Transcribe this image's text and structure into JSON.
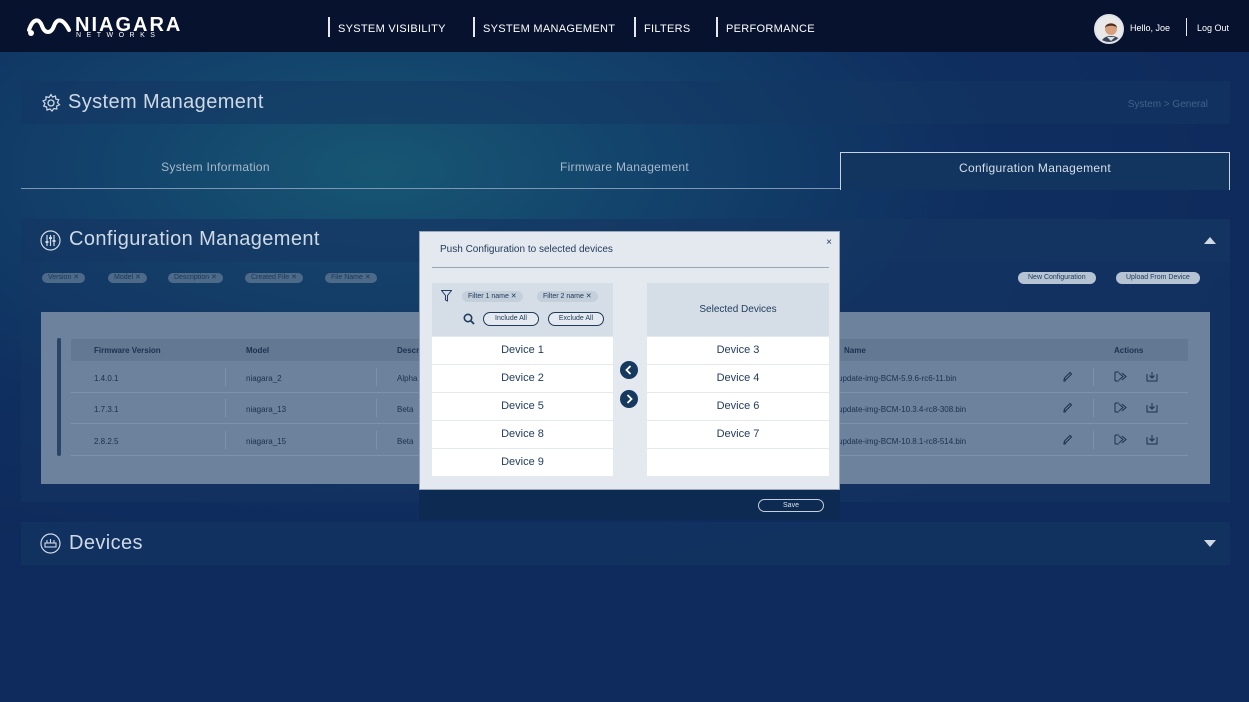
{
  "brand": {
    "name": "NIAGARA",
    "sub": "NETWORKS"
  },
  "nav": [
    "SYSTEM VISIBILITY",
    "SYSTEM MANAGEMENT",
    "FILTERS",
    "PERFORMANCE"
  ],
  "user": {
    "greeting": "Hello, Joe",
    "logout": "Log Out"
  },
  "page": {
    "title": "System Management",
    "breadcrumb": "System > General"
  },
  "tabs": [
    "System Information",
    "Firmware Management",
    "Configuration Management"
  ],
  "config": {
    "title": "Configuration Management",
    "filter_chips": [
      "Version",
      "Model",
      "Description",
      "Created File",
      "File Name"
    ],
    "buttons": {
      "new": "New Configuration",
      "upload": "Upload From Device"
    },
    "columns": {
      "firmware": "Firmware Version",
      "model": "Model",
      "desc": "Descr",
      "filename": "Name",
      "actions": "Actions"
    },
    "rows": [
      {
        "firmware": "1.4.0.1",
        "model": "niagara_2",
        "desc": "Alpha",
        "filename": "update-img-BCM-5.9.6-rc6-11.bin"
      },
      {
        "firmware": "1.7.3.1",
        "model": "niagara_13",
        "desc": "Beta",
        "filename": "update-img-BCM-10.3.4-rc8-308.bin"
      },
      {
        "firmware": "2.8.2.5",
        "model": "niagara_15",
        "desc": "Beta",
        "filename": "update-img-BCM-10.8.1-rc8-514.bin"
      }
    ]
  },
  "modal": {
    "title": "Push Configuration to selected devices",
    "close": "×",
    "filters": [
      {
        "label": "Filter 1 name"
      },
      {
        "label": "Filter 2 name"
      }
    ],
    "include_all": "Include All",
    "exclude_all": "Exclude All",
    "available": [
      "Device 1",
      "Device 2",
      "Device 5",
      "Device 8",
      "Device 9"
    ],
    "selected_title": "Selected Devices",
    "selected": [
      "Device 3",
      "Device 4",
      "Device 6",
      "Device 7"
    ],
    "save": "Save"
  },
  "devices": {
    "title": "Devices"
  }
}
